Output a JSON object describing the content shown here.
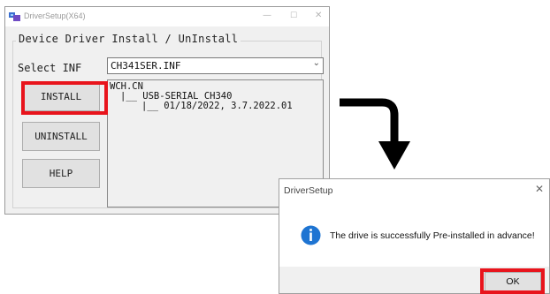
{
  "setup_window": {
    "title": "DriverSetup(X64)",
    "caption_buttons": {
      "minimize": "—",
      "maximize": "☐",
      "close": "✕"
    },
    "group_label": "Device Driver Install / UnInstall",
    "select_inf_label": "Select INF",
    "inf_value": "CH341SER.INF",
    "buttons": {
      "install": "INSTALL",
      "uninstall": "UNINSTALL",
      "help": "HELP"
    },
    "info_lines": [
      "WCH.CN",
      "|__ USB-SERIAL CH340",
      "|__ 01/18/2022, 3.7.2022.01"
    ],
    "highlight_color": "#e8141c"
  },
  "dialog": {
    "title": "DriverSetup",
    "close": "✕",
    "icon": "info-icon",
    "message": "The drive is successfully Pre-installed in advance!",
    "ok_label": "OK",
    "icon_color": "#1e74d2"
  },
  "arrow": {
    "icon": "curved-arrow-down-icon",
    "color": "#000000"
  }
}
